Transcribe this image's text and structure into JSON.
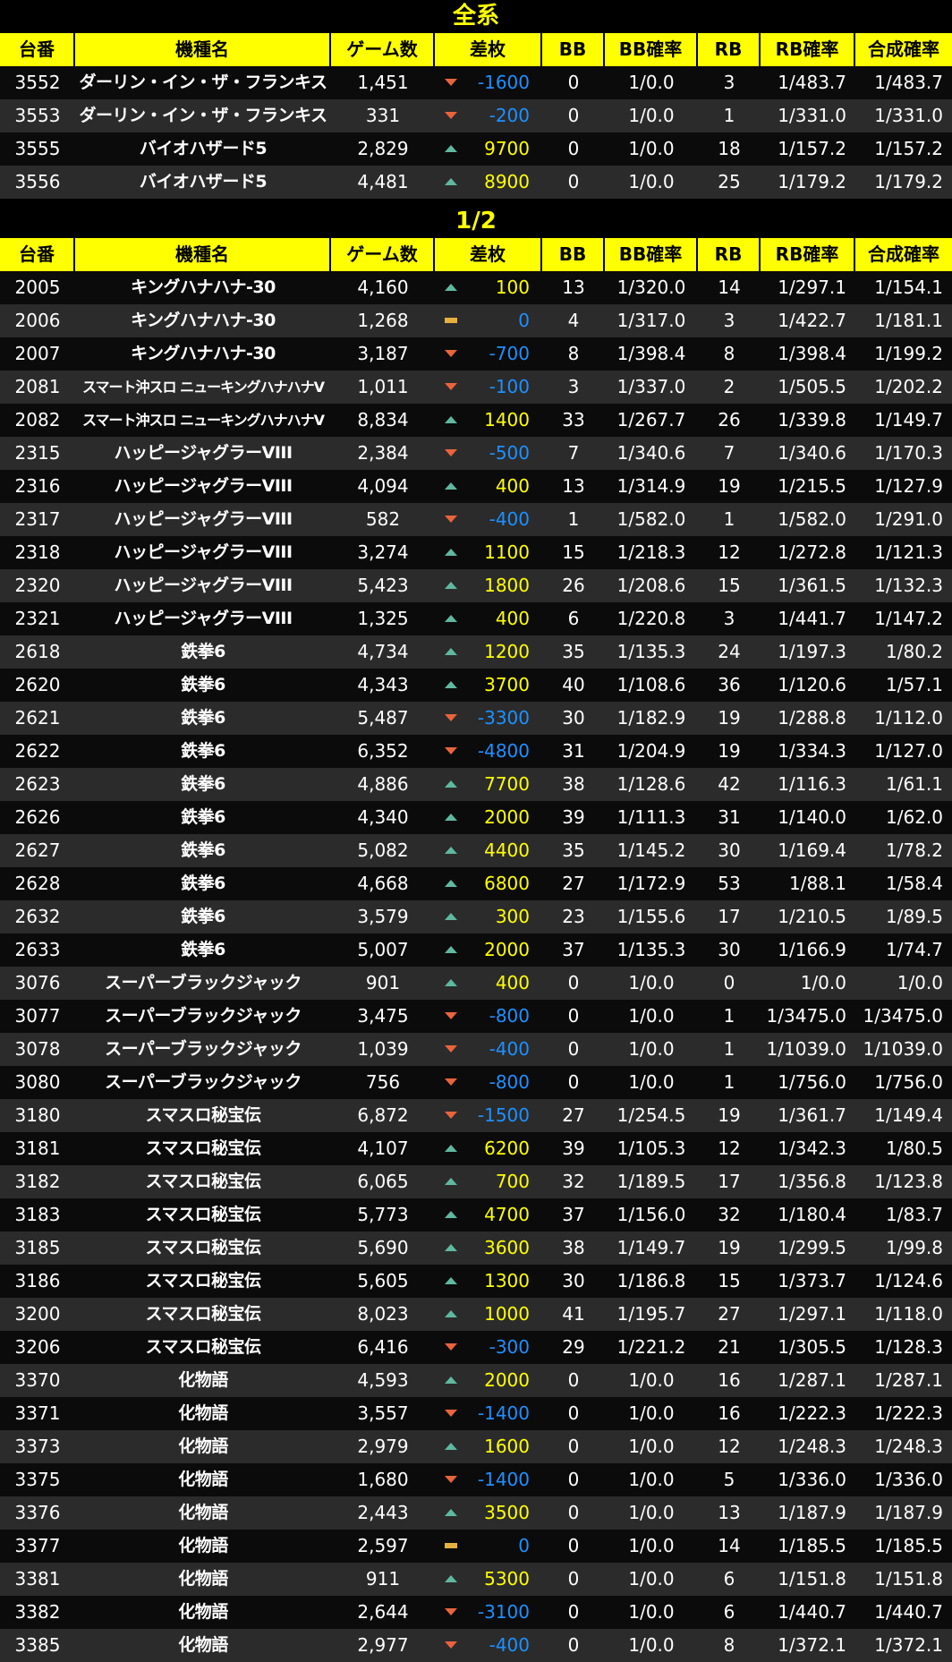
{
  "colors": {
    "header_bg": "#ffff00",
    "title": "#ffff00",
    "positive": "#ffff00",
    "negative": "#1e90ff",
    "up_icon": "#5fb8a0",
    "down_icon": "#e8643c",
    "flat_icon": "#e6b040"
  },
  "headers": [
    "台番",
    "機種名",
    "ゲーム数",
    "差枚",
    "BB",
    "BB確率",
    "RB",
    "RB確率",
    "合成確率"
  ],
  "sections": [
    {
      "title": "全系",
      "rows": [
        {
          "no": "3552",
          "name": "ダーリン・イン・ザ・フランキス",
          "games": "1,451",
          "trend": "down",
          "diff": "-1600",
          "bb": "0",
          "bbr": "1/0.0",
          "rb": "3",
          "rbr": "1/483.7",
          "total": "1/483.7"
        },
        {
          "no": "3553",
          "name": "ダーリン・イン・ザ・フランキス",
          "games": "331",
          "trend": "down",
          "diff": "-200",
          "bb": "0",
          "bbr": "1/0.0",
          "rb": "1",
          "rbr": "1/331.0",
          "total": "1/331.0"
        },
        {
          "no": "3555",
          "name": "バイオハザード5",
          "games": "2,829",
          "trend": "up",
          "diff": "9700",
          "bb": "0",
          "bbr": "1/0.0",
          "rb": "18",
          "rbr": "1/157.2",
          "total": "1/157.2"
        },
        {
          "no": "3556",
          "name": "バイオハザード5",
          "games": "4,481",
          "trend": "up",
          "diff": "8900",
          "bb": "0",
          "bbr": "1/0.0",
          "rb": "25",
          "rbr": "1/179.2",
          "total": "1/179.2"
        }
      ]
    },
    {
      "title": "1/2",
      "rows": [
        {
          "no": "2005",
          "name": "キングハナハナ-30",
          "games": "4,160",
          "trend": "up",
          "diff": "100",
          "bb": "13",
          "bbr": "1/320.0",
          "rb": "14",
          "rbr": "1/297.1",
          "total": "1/154.1"
        },
        {
          "no": "2006",
          "name": "キングハナハナ-30",
          "games": "1,268",
          "trend": "flat",
          "diff": "0",
          "bb": "4",
          "bbr": "1/317.0",
          "rb": "3",
          "rbr": "1/422.7",
          "total": "1/181.1"
        },
        {
          "no": "2007",
          "name": "キングハナハナ-30",
          "games": "3,187",
          "trend": "down",
          "diff": "-700",
          "bb": "8",
          "bbr": "1/398.4",
          "rb": "8",
          "rbr": "1/398.4",
          "total": "1/199.2"
        },
        {
          "no": "2081",
          "name": "スマート沖スロ ニューキングハナハナV",
          "games": "1,011",
          "trend": "down",
          "diff": "-100",
          "bb": "3",
          "bbr": "1/337.0",
          "rb": "2",
          "rbr": "1/505.5",
          "total": "1/202.2"
        },
        {
          "no": "2082",
          "name": "スマート沖スロ ニューキングハナハナV",
          "games": "8,834",
          "trend": "up",
          "diff": "1400",
          "bb": "33",
          "bbr": "1/267.7",
          "rb": "26",
          "rbr": "1/339.8",
          "total": "1/149.7"
        },
        {
          "no": "2315",
          "name": "ハッピージャグラーVIII",
          "games": "2,384",
          "trend": "down",
          "diff": "-500",
          "bb": "7",
          "bbr": "1/340.6",
          "rb": "7",
          "rbr": "1/340.6",
          "total": "1/170.3"
        },
        {
          "no": "2316",
          "name": "ハッピージャグラーVIII",
          "games": "4,094",
          "trend": "up",
          "diff": "400",
          "bb": "13",
          "bbr": "1/314.9",
          "rb": "19",
          "rbr": "1/215.5",
          "total": "1/127.9"
        },
        {
          "no": "2317",
          "name": "ハッピージャグラーVIII",
          "games": "582",
          "trend": "down",
          "diff": "-400",
          "bb": "1",
          "bbr": "1/582.0",
          "rb": "1",
          "rbr": "1/582.0",
          "total": "1/291.0"
        },
        {
          "no": "2318",
          "name": "ハッピージャグラーVIII",
          "games": "3,274",
          "trend": "up",
          "diff": "1100",
          "bb": "15",
          "bbr": "1/218.3",
          "rb": "12",
          "rbr": "1/272.8",
          "total": "1/121.3"
        },
        {
          "no": "2320",
          "name": "ハッピージャグラーVIII",
          "games": "5,423",
          "trend": "up",
          "diff": "1800",
          "bb": "26",
          "bbr": "1/208.6",
          "rb": "15",
          "rbr": "1/361.5",
          "total": "1/132.3"
        },
        {
          "no": "2321",
          "name": "ハッピージャグラーVIII",
          "games": "1,325",
          "trend": "up",
          "diff": "400",
          "bb": "6",
          "bbr": "1/220.8",
          "rb": "3",
          "rbr": "1/441.7",
          "total": "1/147.2"
        },
        {
          "no": "2618",
          "name": "鉄拳6",
          "games": "4,734",
          "trend": "up",
          "diff": "1200",
          "bb": "35",
          "bbr": "1/135.3",
          "rb": "24",
          "rbr": "1/197.3",
          "total": "1/80.2"
        },
        {
          "no": "2620",
          "name": "鉄拳6",
          "games": "4,343",
          "trend": "up",
          "diff": "3700",
          "bb": "40",
          "bbr": "1/108.6",
          "rb": "36",
          "rbr": "1/120.6",
          "total": "1/57.1"
        },
        {
          "no": "2621",
          "name": "鉄拳6",
          "games": "5,487",
          "trend": "down",
          "diff": "-3300",
          "bb": "30",
          "bbr": "1/182.9",
          "rb": "19",
          "rbr": "1/288.8",
          "total": "1/112.0"
        },
        {
          "no": "2622",
          "name": "鉄拳6",
          "games": "6,352",
          "trend": "down",
          "diff": "-4800",
          "bb": "31",
          "bbr": "1/204.9",
          "rb": "19",
          "rbr": "1/334.3",
          "total": "1/127.0"
        },
        {
          "no": "2623",
          "name": "鉄拳6",
          "games": "4,886",
          "trend": "up",
          "diff": "7700",
          "bb": "38",
          "bbr": "1/128.6",
          "rb": "42",
          "rbr": "1/116.3",
          "total": "1/61.1"
        },
        {
          "no": "2626",
          "name": "鉄拳6",
          "games": "4,340",
          "trend": "up",
          "diff": "2000",
          "bb": "39",
          "bbr": "1/111.3",
          "rb": "31",
          "rbr": "1/140.0",
          "total": "1/62.0"
        },
        {
          "no": "2627",
          "name": "鉄拳6",
          "games": "5,082",
          "trend": "up",
          "diff": "4400",
          "bb": "35",
          "bbr": "1/145.2",
          "rb": "30",
          "rbr": "1/169.4",
          "total": "1/78.2"
        },
        {
          "no": "2628",
          "name": "鉄拳6",
          "games": "4,668",
          "trend": "up",
          "diff": "6800",
          "bb": "27",
          "bbr": "1/172.9",
          "rb": "53",
          "rbr": "1/88.1",
          "total": "1/58.4"
        },
        {
          "no": "2632",
          "name": "鉄拳6",
          "games": "3,579",
          "trend": "up",
          "diff": "300",
          "bb": "23",
          "bbr": "1/155.6",
          "rb": "17",
          "rbr": "1/210.5",
          "total": "1/89.5"
        },
        {
          "no": "2633",
          "name": "鉄拳6",
          "games": "5,007",
          "trend": "up",
          "diff": "2000",
          "bb": "37",
          "bbr": "1/135.3",
          "rb": "30",
          "rbr": "1/166.9",
          "total": "1/74.7"
        },
        {
          "no": "3076",
          "name": "スーパーブラックジャック",
          "games": "901",
          "trend": "up",
          "diff": "400",
          "bb": "0",
          "bbr": "1/0.0",
          "rb": "0",
          "rbr": "1/0.0",
          "total": "1/0.0"
        },
        {
          "no": "3077",
          "name": "スーパーブラックジャック",
          "games": "3,475",
          "trend": "down",
          "diff": "-800",
          "bb": "0",
          "bbr": "1/0.0",
          "rb": "1",
          "rbr": "1/3475.0",
          "total": "1/3475.0"
        },
        {
          "no": "3078",
          "name": "スーパーブラックジャック",
          "games": "1,039",
          "trend": "down",
          "diff": "-400",
          "bb": "0",
          "bbr": "1/0.0",
          "rb": "1",
          "rbr": "1/1039.0",
          "total": "1/1039.0"
        },
        {
          "no": "3080",
          "name": "スーパーブラックジャック",
          "games": "756",
          "trend": "down",
          "diff": "-800",
          "bb": "0",
          "bbr": "1/0.0",
          "rb": "1",
          "rbr": "1/756.0",
          "total": "1/756.0"
        },
        {
          "no": "3180",
          "name": "スマスロ秘宝伝",
          "games": "6,872",
          "trend": "down",
          "diff": "-1500",
          "bb": "27",
          "bbr": "1/254.5",
          "rb": "19",
          "rbr": "1/361.7",
          "total": "1/149.4"
        },
        {
          "no": "3181",
          "name": "スマスロ秘宝伝",
          "games": "4,107",
          "trend": "up",
          "diff": "6200",
          "bb": "39",
          "bbr": "1/105.3",
          "rb": "12",
          "rbr": "1/342.3",
          "total": "1/80.5"
        },
        {
          "no": "3182",
          "name": "スマスロ秘宝伝",
          "games": "6,065",
          "trend": "up",
          "diff": "700",
          "bb": "32",
          "bbr": "1/189.5",
          "rb": "17",
          "rbr": "1/356.8",
          "total": "1/123.8"
        },
        {
          "no": "3183",
          "name": "スマスロ秘宝伝",
          "games": "5,773",
          "trend": "up",
          "diff": "4700",
          "bb": "37",
          "bbr": "1/156.0",
          "rb": "32",
          "rbr": "1/180.4",
          "total": "1/83.7"
        },
        {
          "no": "3185",
          "name": "スマスロ秘宝伝",
          "games": "5,690",
          "trend": "up",
          "diff": "3600",
          "bb": "38",
          "bbr": "1/149.7",
          "rb": "19",
          "rbr": "1/299.5",
          "total": "1/99.8"
        },
        {
          "no": "3186",
          "name": "スマスロ秘宝伝",
          "games": "5,605",
          "trend": "up",
          "diff": "1300",
          "bb": "30",
          "bbr": "1/186.8",
          "rb": "15",
          "rbr": "1/373.7",
          "total": "1/124.6"
        },
        {
          "no": "3200",
          "name": "スマスロ秘宝伝",
          "games": "8,023",
          "trend": "up",
          "diff": "1000",
          "bb": "41",
          "bbr": "1/195.7",
          "rb": "27",
          "rbr": "1/297.1",
          "total": "1/118.0"
        },
        {
          "no": "3206",
          "name": "スマスロ秘宝伝",
          "games": "6,416",
          "trend": "down",
          "diff": "-300",
          "bb": "29",
          "bbr": "1/221.2",
          "rb": "21",
          "rbr": "1/305.5",
          "total": "1/128.3"
        },
        {
          "no": "3370",
          "name": "化物語",
          "games": "4,593",
          "trend": "up",
          "diff": "2000",
          "bb": "0",
          "bbr": "1/0.0",
          "rb": "16",
          "rbr": "1/287.1",
          "total": "1/287.1"
        },
        {
          "no": "3371",
          "name": "化物語",
          "games": "3,557",
          "trend": "down",
          "diff": "-1400",
          "bb": "0",
          "bbr": "1/0.0",
          "rb": "16",
          "rbr": "1/222.3",
          "total": "1/222.3"
        },
        {
          "no": "3373",
          "name": "化物語",
          "games": "2,979",
          "trend": "up",
          "diff": "1600",
          "bb": "0",
          "bbr": "1/0.0",
          "rb": "12",
          "rbr": "1/248.3",
          "total": "1/248.3"
        },
        {
          "no": "3375",
          "name": "化物語",
          "games": "1,680",
          "trend": "down",
          "diff": "-1400",
          "bb": "0",
          "bbr": "1/0.0",
          "rb": "5",
          "rbr": "1/336.0",
          "total": "1/336.0"
        },
        {
          "no": "3376",
          "name": "化物語",
          "games": "2,443",
          "trend": "up",
          "diff": "3500",
          "bb": "0",
          "bbr": "1/0.0",
          "rb": "13",
          "rbr": "1/187.9",
          "total": "1/187.9"
        },
        {
          "no": "3377",
          "name": "化物語",
          "games": "2,597",
          "trend": "flat",
          "diff": "0",
          "bb": "0",
          "bbr": "1/0.0",
          "rb": "14",
          "rbr": "1/185.5",
          "total": "1/185.5"
        },
        {
          "no": "3381",
          "name": "化物語",
          "games": "911",
          "trend": "up",
          "diff": "5300",
          "bb": "0",
          "bbr": "1/0.0",
          "rb": "6",
          "rbr": "1/151.8",
          "total": "1/151.8"
        },
        {
          "no": "3382",
          "name": "化物語",
          "games": "2,644",
          "trend": "down",
          "diff": "-3100",
          "bb": "0",
          "bbr": "1/0.0",
          "rb": "6",
          "rbr": "1/440.7",
          "total": "1/440.7"
        },
        {
          "no": "3385",
          "name": "化物語",
          "games": "2,977",
          "trend": "down",
          "diff": "-400",
          "bb": "0",
          "bbr": "1/0.0",
          "rb": "8",
          "rbr": "1/372.1",
          "total": "1/372.1"
        }
      ]
    }
  ]
}
